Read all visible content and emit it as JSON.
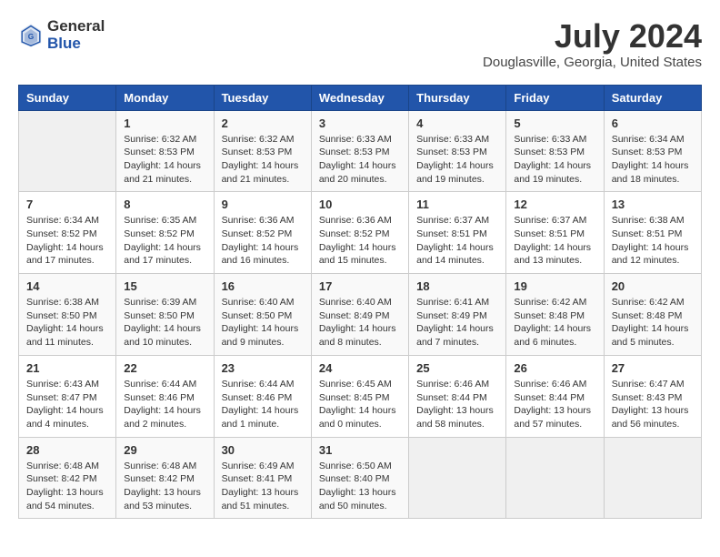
{
  "header": {
    "logo_general": "General",
    "logo_blue": "Blue",
    "title": "July 2024",
    "subtitle": "Douglasville, Georgia, United States"
  },
  "columns": [
    "Sunday",
    "Monday",
    "Tuesday",
    "Wednesday",
    "Thursday",
    "Friday",
    "Saturday"
  ],
  "weeks": [
    [
      {
        "day": "",
        "info": ""
      },
      {
        "day": "1",
        "info": "Sunrise: 6:32 AM\nSunset: 8:53 PM\nDaylight: 14 hours\nand 21 minutes."
      },
      {
        "day": "2",
        "info": "Sunrise: 6:32 AM\nSunset: 8:53 PM\nDaylight: 14 hours\nand 21 minutes."
      },
      {
        "day": "3",
        "info": "Sunrise: 6:33 AM\nSunset: 8:53 PM\nDaylight: 14 hours\nand 20 minutes."
      },
      {
        "day": "4",
        "info": "Sunrise: 6:33 AM\nSunset: 8:53 PM\nDaylight: 14 hours\nand 19 minutes."
      },
      {
        "day": "5",
        "info": "Sunrise: 6:33 AM\nSunset: 8:53 PM\nDaylight: 14 hours\nand 19 minutes."
      },
      {
        "day": "6",
        "info": "Sunrise: 6:34 AM\nSunset: 8:53 PM\nDaylight: 14 hours\nand 18 minutes."
      }
    ],
    [
      {
        "day": "7",
        "info": "Sunrise: 6:34 AM\nSunset: 8:52 PM\nDaylight: 14 hours\nand 17 minutes."
      },
      {
        "day": "8",
        "info": "Sunrise: 6:35 AM\nSunset: 8:52 PM\nDaylight: 14 hours\nand 17 minutes."
      },
      {
        "day": "9",
        "info": "Sunrise: 6:36 AM\nSunset: 8:52 PM\nDaylight: 14 hours\nand 16 minutes."
      },
      {
        "day": "10",
        "info": "Sunrise: 6:36 AM\nSunset: 8:52 PM\nDaylight: 14 hours\nand 15 minutes."
      },
      {
        "day": "11",
        "info": "Sunrise: 6:37 AM\nSunset: 8:51 PM\nDaylight: 14 hours\nand 14 minutes."
      },
      {
        "day": "12",
        "info": "Sunrise: 6:37 AM\nSunset: 8:51 PM\nDaylight: 14 hours\nand 13 minutes."
      },
      {
        "day": "13",
        "info": "Sunrise: 6:38 AM\nSunset: 8:51 PM\nDaylight: 14 hours\nand 12 minutes."
      }
    ],
    [
      {
        "day": "14",
        "info": "Sunrise: 6:38 AM\nSunset: 8:50 PM\nDaylight: 14 hours\nand 11 minutes."
      },
      {
        "day": "15",
        "info": "Sunrise: 6:39 AM\nSunset: 8:50 PM\nDaylight: 14 hours\nand 10 minutes."
      },
      {
        "day": "16",
        "info": "Sunrise: 6:40 AM\nSunset: 8:50 PM\nDaylight: 14 hours\nand 9 minutes."
      },
      {
        "day": "17",
        "info": "Sunrise: 6:40 AM\nSunset: 8:49 PM\nDaylight: 14 hours\nand 8 minutes."
      },
      {
        "day": "18",
        "info": "Sunrise: 6:41 AM\nSunset: 8:49 PM\nDaylight: 14 hours\nand 7 minutes."
      },
      {
        "day": "19",
        "info": "Sunrise: 6:42 AM\nSunset: 8:48 PM\nDaylight: 14 hours\nand 6 minutes."
      },
      {
        "day": "20",
        "info": "Sunrise: 6:42 AM\nSunset: 8:48 PM\nDaylight: 14 hours\nand 5 minutes."
      }
    ],
    [
      {
        "day": "21",
        "info": "Sunrise: 6:43 AM\nSunset: 8:47 PM\nDaylight: 14 hours\nand 4 minutes."
      },
      {
        "day": "22",
        "info": "Sunrise: 6:44 AM\nSunset: 8:46 PM\nDaylight: 14 hours\nand 2 minutes."
      },
      {
        "day": "23",
        "info": "Sunrise: 6:44 AM\nSunset: 8:46 PM\nDaylight: 14 hours\nand 1 minute."
      },
      {
        "day": "24",
        "info": "Sunrise: 6:45 AM\nSunset: 8:45 PM\nDaylight: 14 hours\nand 0 minutes."
      },
      {
        "day": "25",
        "info": "Sunrise: 6:46 AM\nSunset: 8:44 PM\nDaylight: 13 hours\nand 58 minutes."
      },
      {
        "day": "26",
        "info": "Sunrise: 6:46 AM\nSunset: 8:44 PM\nDaylight: 13 hours\nand 57 minutes."
      },
      {
        "day": "27",
        "info": "Sunrise: 6:47 AM\nSunset: 8:43 PM\nDaylight: 13 hours\nand 56 minutes."
      }
    ],
    [
      {
        "day": "28",
        "info": "Sunrise: 6:48 AM\nSunset: 8:42 PM\nDaylight: 13 hours\nand 54 minutes."
      },
      {
        "day": "29",
        "info": "Sunrise: 6:48 AM\nSunset: 8:42 PM\nDaylight: 13 hours\nand 53 minutes."
      },
      {
        "day": "30",
        "info": "Sunrise: 6:49 AM\nSunset: 8:41 PM\nDaylight: 13 hours\nand 51 minutes."
      },
      {
        "day": "31",
        "info": "Sunrise: 6:50 AM\nSunset: 8:40 PM\nDaylight: 13 hours\nand 50 minutes."
      },
      {
        "day": "",
        "info": ""
      },
      {
        "day": "",
        "info": ""
      },
      {
        "day": "",
        "info": ""
      }
    ]
  ]
}
